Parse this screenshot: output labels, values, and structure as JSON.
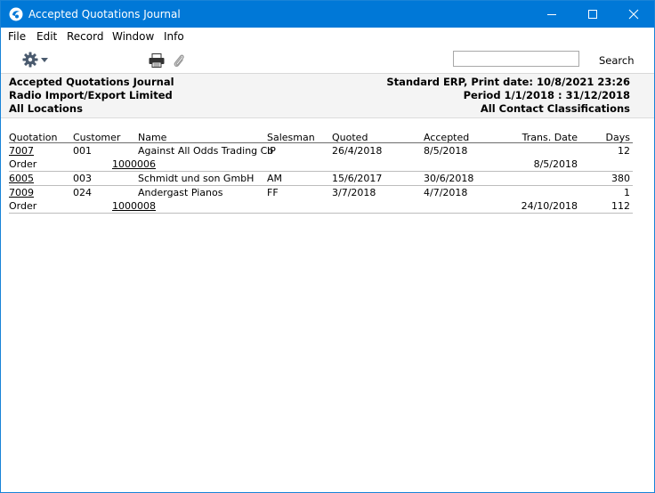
{
  "window": {
    "title": "Accepted Quotations Journal"
  },
  "menu": [
    "File",
    "Edit",
    "Record",
    "Window",
    "Info"
  ],
  "toolbar": {
    "search_value": "",
    "search_label": "Search"
  },
  "report": {
    "left": [
      "Accepted Quotations Journal",
      "Radio Import/Export Limited",
      "All Locations"
    ],
    "right": [
      "Standard ERP, Print date:  10/8/2021 23:26",
      "Period   1/1/2018 : 31/12/2018",
      "All Contact Classifications"
    ]
  },
  "columns": {
    "quotation": "Quotation",
    "customer": "Customer",
    "name": "Name",
    "salesman": "Salesman",
    "quoted": "Quoted",
    "accepted": "Accepted",
    "trans_date": "Trans. Date",
    "days": "Days"
  },
  "rows": [
    {
      "quotation": "7007",
      "customer": "001",
      "name": "Against All Odds Trading Co",
      "salesman": "IP",
      "quoted": "26/4/2018",
      "accepted": "8/5/2018",
      "days": "12",
      "order": {
        "label": "Order",
        "number": "1000006",
        "date": "8/5/2018",
        "days": ""
      }
    },
    {
      "quotation": "6005",
      "customer": "003",
      "name": "Schmidt und son GmbH",
      "salesman": "AM",
      "quoted": "15/6/2017",
      "accepted": "30/6/2018",
      "days": "380"
    },
    {
      "quotation": "7009",
      "customer": "024",
      "name": "Andergast Pianos",
      "salesman": "FF",
      "quoted": "3/7/2018",
      "accepted": "4/7/2018",
      "days": "1",
      "order": {
        "label": "Order",
        "number": "1000008",
        "date": "24/10/2018",
        "days": "112"
      }
    }
  ]
}
